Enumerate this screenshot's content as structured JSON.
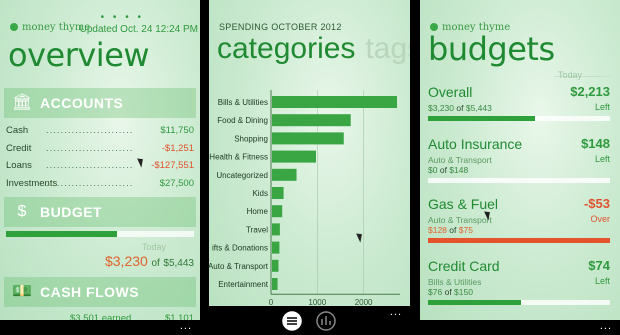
{
  "overview": {
    "brand": "money thyme",
    "updated": "Updated Oct. 24 12:24 PM",
    "title": "overview",
    "accounts_label": "ACCOUNTS",
    "accounts": [
      {
        "name": "Cash",
        "amount": "$11,750",
        "negative": false
      },
      {
        "name": "Credit",
        "amount": "-$1,251",
        "negative": true
      },
      {
        "name": "Loans",
        "amount": "-$127,551",
        "negative": true
      },
      {
        "name": "Investments",
        "amount": "$27,500",
        "negative": false
      }
    ],
    "budget_label": "BUDGET",
    "budget_progress": 0.59,
    "today_label": "Today",
    "budget_spent": "$3,230",
    "budget_of": "of",
    "budget_total": "$5,443",
    "cashflows_label": "CASH FLOWS",
    "cashflow_partial": "$3,501 earned",
    "cashflow_partial_right": "$1,101",
    "more": "..."
  },
  "categories": {
    "heading": "SPENDING OCTOBER 2012",
    "tab_active": "categories",
    "tab_inactive": "tags",
    "more": "...",
    "chart_data": {
      "type": "bar",
      "orientation": "horizontal",
      "categories": [
        "Bills & Utilities",
        "Food & Dining",
        "Shopping",
        "Health & Fitness",
        "Uncategorized",
        "Kids",
        "Home",
        "Travel",
        "Gifts & Donations",
        "Auto & Transport",
        "Entertainment"
      ],
      "category_labels": [
        "Bills & Utilities",
        "Food & Dining",
        "Shopping",
        "Health & Fitness",
        "Uncategorized",
        "Kids",
        "Home",
        "Travel",
        "ifts & Donations",
        "Auto & Transport",
        "Entertainment"
      ],
      "values": [
        2700,
        1700,
        1550,
        950,
        530,
        250,
        220,
        170,
        160,
        140,
        120
      ],
      "xlim": [
        0,
        2700
      ],
      "xticks": [
        "0",
        "1000",
        "2000"
      ],
      "grid": true,
      "color": "#3aa543"
    }
  },
  "budgets": {
    "brand": "money thyme",
    "title": "budgets",
    "today_label": "Today",
    "more": "...",
    "items": [
      {
        "name": "Overall",
        "sub": "",
        "spent": "$3,230",
        "of": "of",
        "total": "$5,443",
        "value": "$2,213",
        "state": "Left",
        "progress": 0.59,
        "over": false
      },
      {
        "name": "Auto Insurance",
        "sub": "Auto & Transport",
        "spent": "$0",
        "of": "of",
        "total": "$148",
        "value": "$148",
        "state": "Left",
        "progress": 0.0,
        "over": false
      },
      {
        "name": "Gas & Fuel",
        "sub": "Auto & Transport",
        "spent": "$128",
        "of": "of",
        "total": "$75",
        "value": "-$53",
        "state": "Over",
        "progress": 1.0,
        "over": true
      },
      {
        "name": "Credit Card",
        "sub": "Bills & Utilities",
        "spent": "$76",
        "of": "of",
        "total": "$150",
        "value": "$74",
        "state": "Left",
        "progress": 0.51,
        "over": false
      }
    ]
  }
}
